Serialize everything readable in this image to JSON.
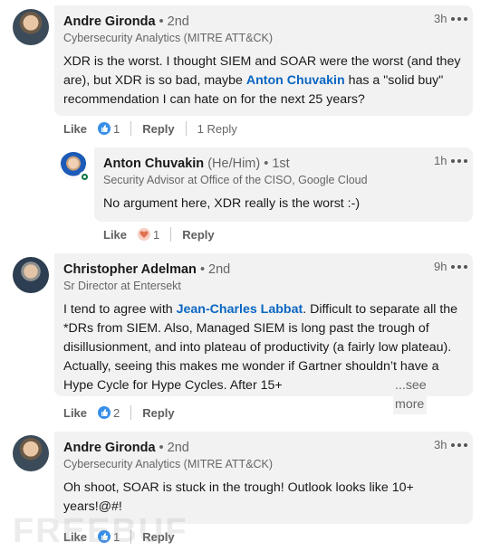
{
  "comments": [
    {
      "author": "Andre Gironda",
      "degree": "• 2nd",
      "headline": "Cybersecurity Analytics (MITRE ATT&CK)",
      "time": "3h",
      "text_before": "XDR is the worst. I thought SIEM and SOAR were the worst (and they are), but XDR is so bad, maybe ",
      "mention": "Anton Chuvakin",
      "text_after": " has a \"solid buy\" recommendation I can hate on for the next 25 years?",
      "like_label": "Like",
      "reaction_count": "1",
      "reply_label": "Reply",
      "replies_label": "1 Reply"
    },
    {
      "author": "Anton Chuvakin",
      "pronouns": "(He/Him)",
      "degree": "• 1st",
      "headline": "Security Advisor at Office of the CISO, Google Cloud",
      "time": "1h",
      "text": "No argument here, XDR really is the worst :-)",
      "like_label": "Like",
      "reaction_count": "1",
      "reply_label": "Reply"
    },
    {
      "author": "Christopher Adelman",
      "degree": "• 2nd",
      "headline": "Sr Director at Entersekt",
      "time": "9h",
      "text_before": "I tend to agree with ",
      "mention": "Jean-Charles Labbat",
      "text_after": ". Difficult to separate all the *DRs from SIEM. Also, Managed SIEM is long past the trough of disillusionment, and into plateau of productivity (a fairly low plateau). Actually, seeing this makes me wonder if Gartner shouldn’t have a Hype Cycle for Hype Cycles. After 15+",
      "see_more": "...see more",
      "like_label": "Like",
      "reaction_count": "2",
      "reply_label": "Reply"
    },
    {
      "author": "Andre Gironda",
      "degree": "• 2nd",
      "headline": "Cybersecurity Analytics (MITRE ATT&CK)",
      "time": "3h",
      "text": "Oh shoot, SOAR is stuck in the trough! Outlook looks like 10+ years!@#!",
      "like_label": "Like",
      "reaction_count": "1",
      "reply_label": "Reply"
    }
  ],
  "watermark": "FREEBUF"
}
